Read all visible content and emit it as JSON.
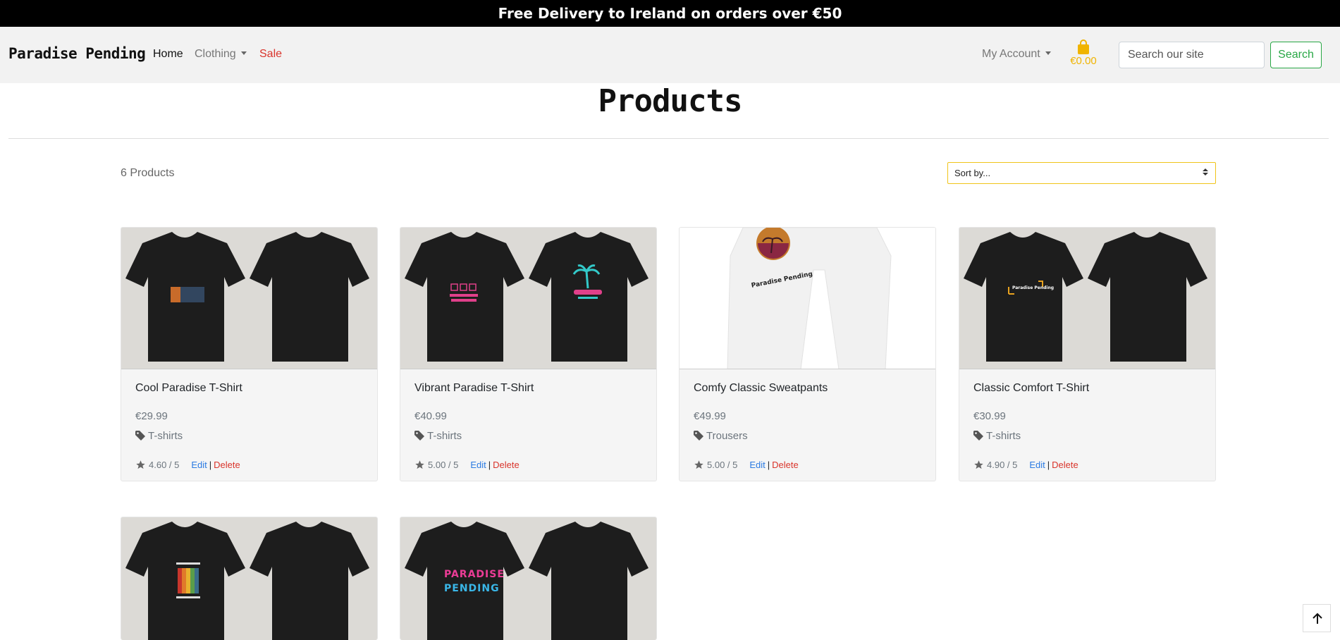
{
  "promo": {
    "text": "Free Delivery to Ireland on orders over €50"
  },
  "navbar": {
    "brand": "Paradise Pending",
    "links": {
      "home": "Home",
      "clothing": "Clothing",
      "sale": "Sale"
    },
    "account": "My Account",
    "cart_total": "€0.00",
    "search_placeholder": "Search our site",
    "search_button": "Search",
    "cart_color": "#f0b400",
    "sale_color": "#d9342b",
    "search_color": "#28a745"
  },
  "main": {
    "title": "Products",
    "product_count": "6 Products",
    "sort_label": "Sort by..."
  },
  "products": [
    {
      "name": "Cool Paradise T-Shirt",
      "price": "€29.99",
      "category": "T-shirts",
      "rating": "4.60 / 5",
      "edit": "Edit",
      "separator": "|",
      "delete": "Delete"
    },
    {
      "name": "Vibrant Paradise T-Shirt",
      "price": "€40.99",
      "category": "T-shirts",
      "rating": "5.00 / 5",
      "edit": "Edit",
      "separator": "|",
      "delete": "Delete"
    },
    {
      "name": "Comfy Classic Sweatpants",
      "price": "€49.99",
      "category": "Trousers",
      "rating": "5.00 / 5",
      "edit": "Edit",
      "separator": "|",
      "delete": "Delete",
      "print_text": "Paradise Pending"
    },
    {
      "name": "Classic Comfort T-Shirt",
      "price": "€30.99",
      "category": "T-shirts",
      "rating": "4.90 / 5",
      "edit": "Edit",
      "separator": "|",
      "delete": "Delete",
      "print_text": "Paradise Pending"
    },
    {
      "image_only": true
    },
    {
      "image_only": true,
      "print_line1": "PARADISE",
      "print_line2": "PENDING"
    }
  ],
  "icons": {
    "cart": "shopping-bag-icon",
    "tag": "tag-icon",
    "star": "star-icon",
    "back_to_top": "arrow-up-icon"
  }
}
